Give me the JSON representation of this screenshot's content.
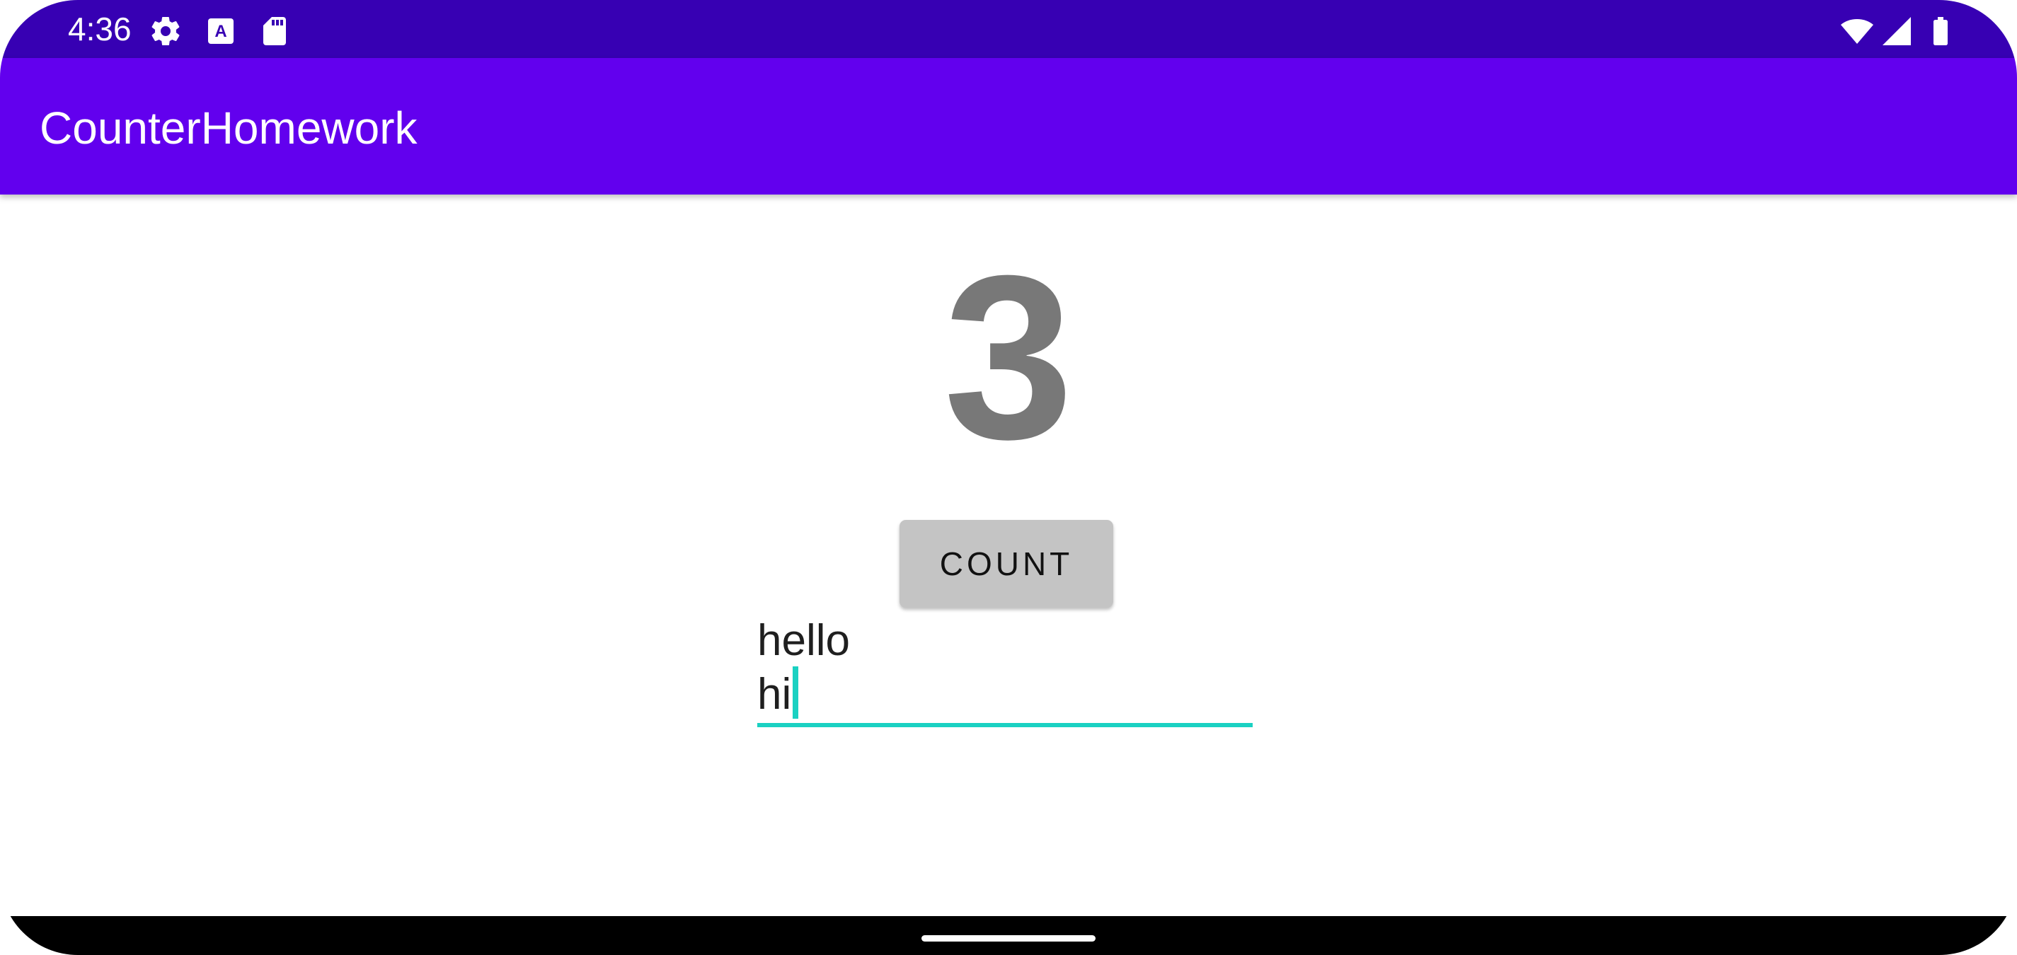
{
  "status_bar": {
    "time": "4:36",
    "left_icons": [
      "gear-icon",
      "text-a-icon",
      "sd-card-icon"
    ],
    "right_icons": [
      "wifi-icon",
      "cell-signal-icon",
      "battery-icon"
    ]
  },
  "app_bar": {
    "title": "CounterHomework"
  },
  "main": {
    "counter_value": "3",
    "count_button_label": "COUNT",
    "edit_text": {
      "line1": "hello",
      "line2": "hi"
    }
  },
  "colors": {
    "status_bar": "#3700b3",
    "app_bar": "#6200ee",
    "accent": "#1ad1c2",
    "counter_text": "#787878",
    "button": "#c4c4c4"
  }
}
